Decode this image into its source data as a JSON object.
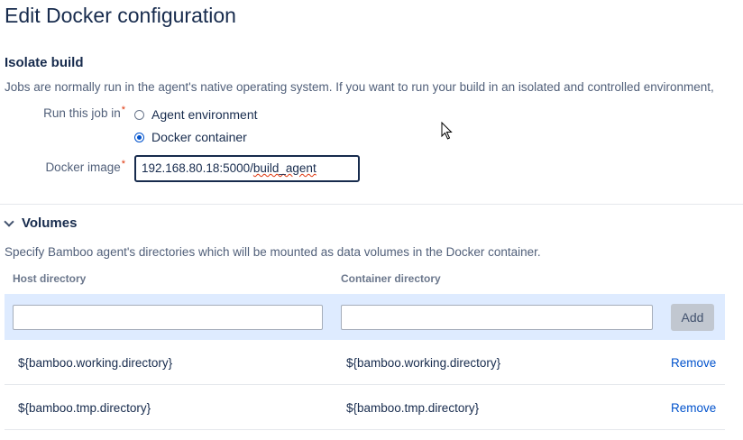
{
  "header": {
    "title": "Edit Docker configuration"
  },
  "isolate": {
    "title": "Isolate build",
    "description": "Jobs are normally run in the agent's native operating system. If you want to run your build in an isolated and controlled environment,",
    "run_label": "Run this job in",
    "required_mark": "*",
    "options": [
      "Agent environment",
      "Docker container"
    ],
    "selected": "Docker container",
    "image_label": "Docker image",
    "image_value_prefix": "192.168.80.18:5000/",
    "image_value_suffix": "build_agent"
  },
  "volumes": {
    "title": "Volumes",
    "description": "Specify Bamboo agent's directories which will be mounted as data volumes in the Docker container.",
    "columns": {
      "host": "Host directory",
      "container": "Container directory"
    },
    "add_label": "Add",
    "rows": [
      {
        "host": "${bamboo.working.directory}",
        "container": "${bamboo.working.directory}",
        "action": "Remove"
      },
      {
        "host": "${bamboo.tmp.directory}",
        "container": "${bamboo.tmp.directory}",
        "action": "Remove"
      }
    ]
  },
  "colors": {
    "accent": "#0052cc",
    "required": "#de350b",
    "add_row_bg": "#deebff",
    "text": "#172b4d"
  }
}
